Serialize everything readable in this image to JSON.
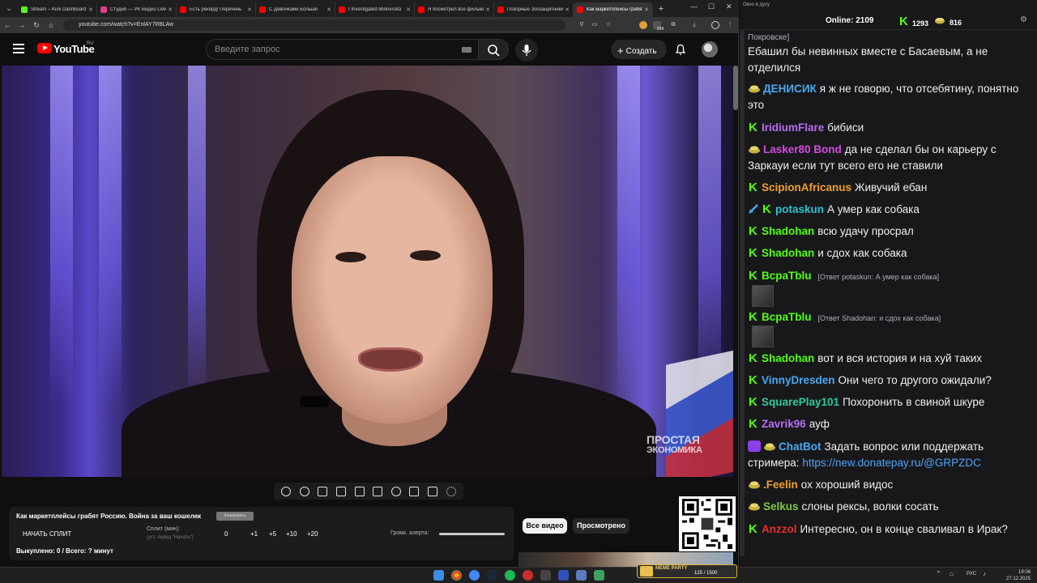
{
  "browser": {
    "tabs": [
      {
        "label": "Stream – Kick Dashboard",
        "color": "#53fc18"
      },
      {
        "label": "Студия — VK Видео Live",
        "color": "#e0408a"
      },
      {
        "label": "Есть рекорд! Перечень",
        "color": "#ff0000"
      },
      {
        "label": "С Девочками Больше",
        "color": "#ff0000"
      },
      {
        "label": "I Investigated Minnesota",
        "color": "#ff0000"
      },
      {
        "label": "Я посмотрел все фильмы",
        "color": "#ff0000"
      },
      {
        "label": "Позорные Зоозащитники",
        "color": "#ff0000"
      },
      {
        "label": "Как маркетплейсы грабят",
        "color": "#ff0000"
      }
    ],
    "url": "youtube.com/watch?v=EnlAY7R8LAw",
    "ext_count": "224"
  },
  "youtube": {
    "logo_text": "YouTube",
    "region": "RU",
    "search_placeholder": "Введите запрос",
    "create_label": "Создать",
    "watermark_line1": "ПРОСТАЯ",
    "watermark_line2": "ЭКОНОМИКА"
  },
  "panel": {
    "title": "Как маркетплейсы грабят Россию. Война за ваш кошелек",
    "copy_label": "Копировать",
    "start_split": "НАЧАТЬ СПЛИТ",
    "split_label": "Сплит (мин):",
    "split_hint": "(уст. перед \"Начать\")",
    "split_value": "0",
    "buttons": [
      "+1",
      "+5",
      "+10",
      "+20"
    ],
    "volume_label": "Громк. алерта:",
    "bought": "Выкуплено: 0 / Всего: ? минут",
    "volume_level": 1.0
  },
  "filters": {
    "all_videos": "Все видео",
    "watched": "Просмотрено"
  },
  "chat": {
    "window_title": "Окно в духу",
    "online_label": "Online:",
    "online_value": "2109",
    "kick_count": "1293",
    "food_count": "816",
    "messages": [
      {
        "user": "",
        "text": "Покровске]",
        "color": "#efeff1"
      },
      {
        "user": "",
        "text": "Ебашил бы невинных вместе с Басаевым, а не отделился",
        "color": "#efeff1"
      },
      {
        "user": "ДЕНИСИК",
        "text": "я ж не говорю, что отсебятину, понятно это",
        "color": "#4aa8f0"
      },
      {
        "user": "IridiumFlare",
        "text": "бибиси",
        "color": "#b86cf0"
      },
      {
        "user": "Lasker80 Bond",
        "text": "да не сделал бы он карьеру с Заркауи если тут всего его не ставили",
        "color": "#d54ae0"
      },
      {
        "user": "ScipionAfricanus",
        "text": "Живучий ебан",
        "color": "#f0a030"
      },
      {
        "user": "potaskun",
        "text": "А умер как собака",
        "color": "#30c0d0"
      },
      {
        "user": "Shadohan",
        "text": "всю удачу просрал",
        "color": "#53fc18"
      },
      {
        "user": "Shadohan",
        "text": "и сдох как собака",
        "color": "#53fc18"
      },
      {
        "user": "BcpaTblu",
        "text": "",
        "reply": "[Ответ potaskun: А умер как собака]",
        "color": "#53fc18"
      },
      {
        "user": "BcpaTblu",
        "text": "",
        "reply": "[Ответ Shadohan: и сдох как собака]",
        "color": "#53fc18"
      },
      {
        "user": "Shadohan",
        "text": "вот и вся история и на хуй таких",
        "color": "#53fc18"
      },
      {
        "user": "VinnyDresden",
        "text": "Они чего то другого ожидали?",
        "color": "#4aa8f0"
      },
      {
        "user": "SquarePlay101",
        "text": "Похоронить в свиной шкуре",
        "color": "#30c8a0"
      },
      {
        "user": "Zavrik96",
        "text": "ауф",
        "color": "#b86cf0"
      },
      {
        "user": "ChatBot",
        "text": "Задать вопрос или поддержать стримера:",
        "link": "https://new.donatepay.ru/@GRPZDC",
        "color": "#4aa8f0"
      },
      {
        "user": ".Feelin",
        "text": "ох хороший видос",
        "color": "#f0a030"
      },
      {
        "user": "Selkus",
        "text": "слоны рексы, волки сосать",
        "color": "#80c840"
      },
      {
        "user": "Anzzol",
        "text": "Интересно, он в конце сваливал в Ирак?",
        "color": "#e03030"
      }
    ]
  },
  "taskbar": {
    "meme_label": "MEME PARTY",
    "meme_progress": "125 / 1500",
    "lang": "РУС",
    "time": "19:06",
    "date": "27.12.2025"
  }
}
